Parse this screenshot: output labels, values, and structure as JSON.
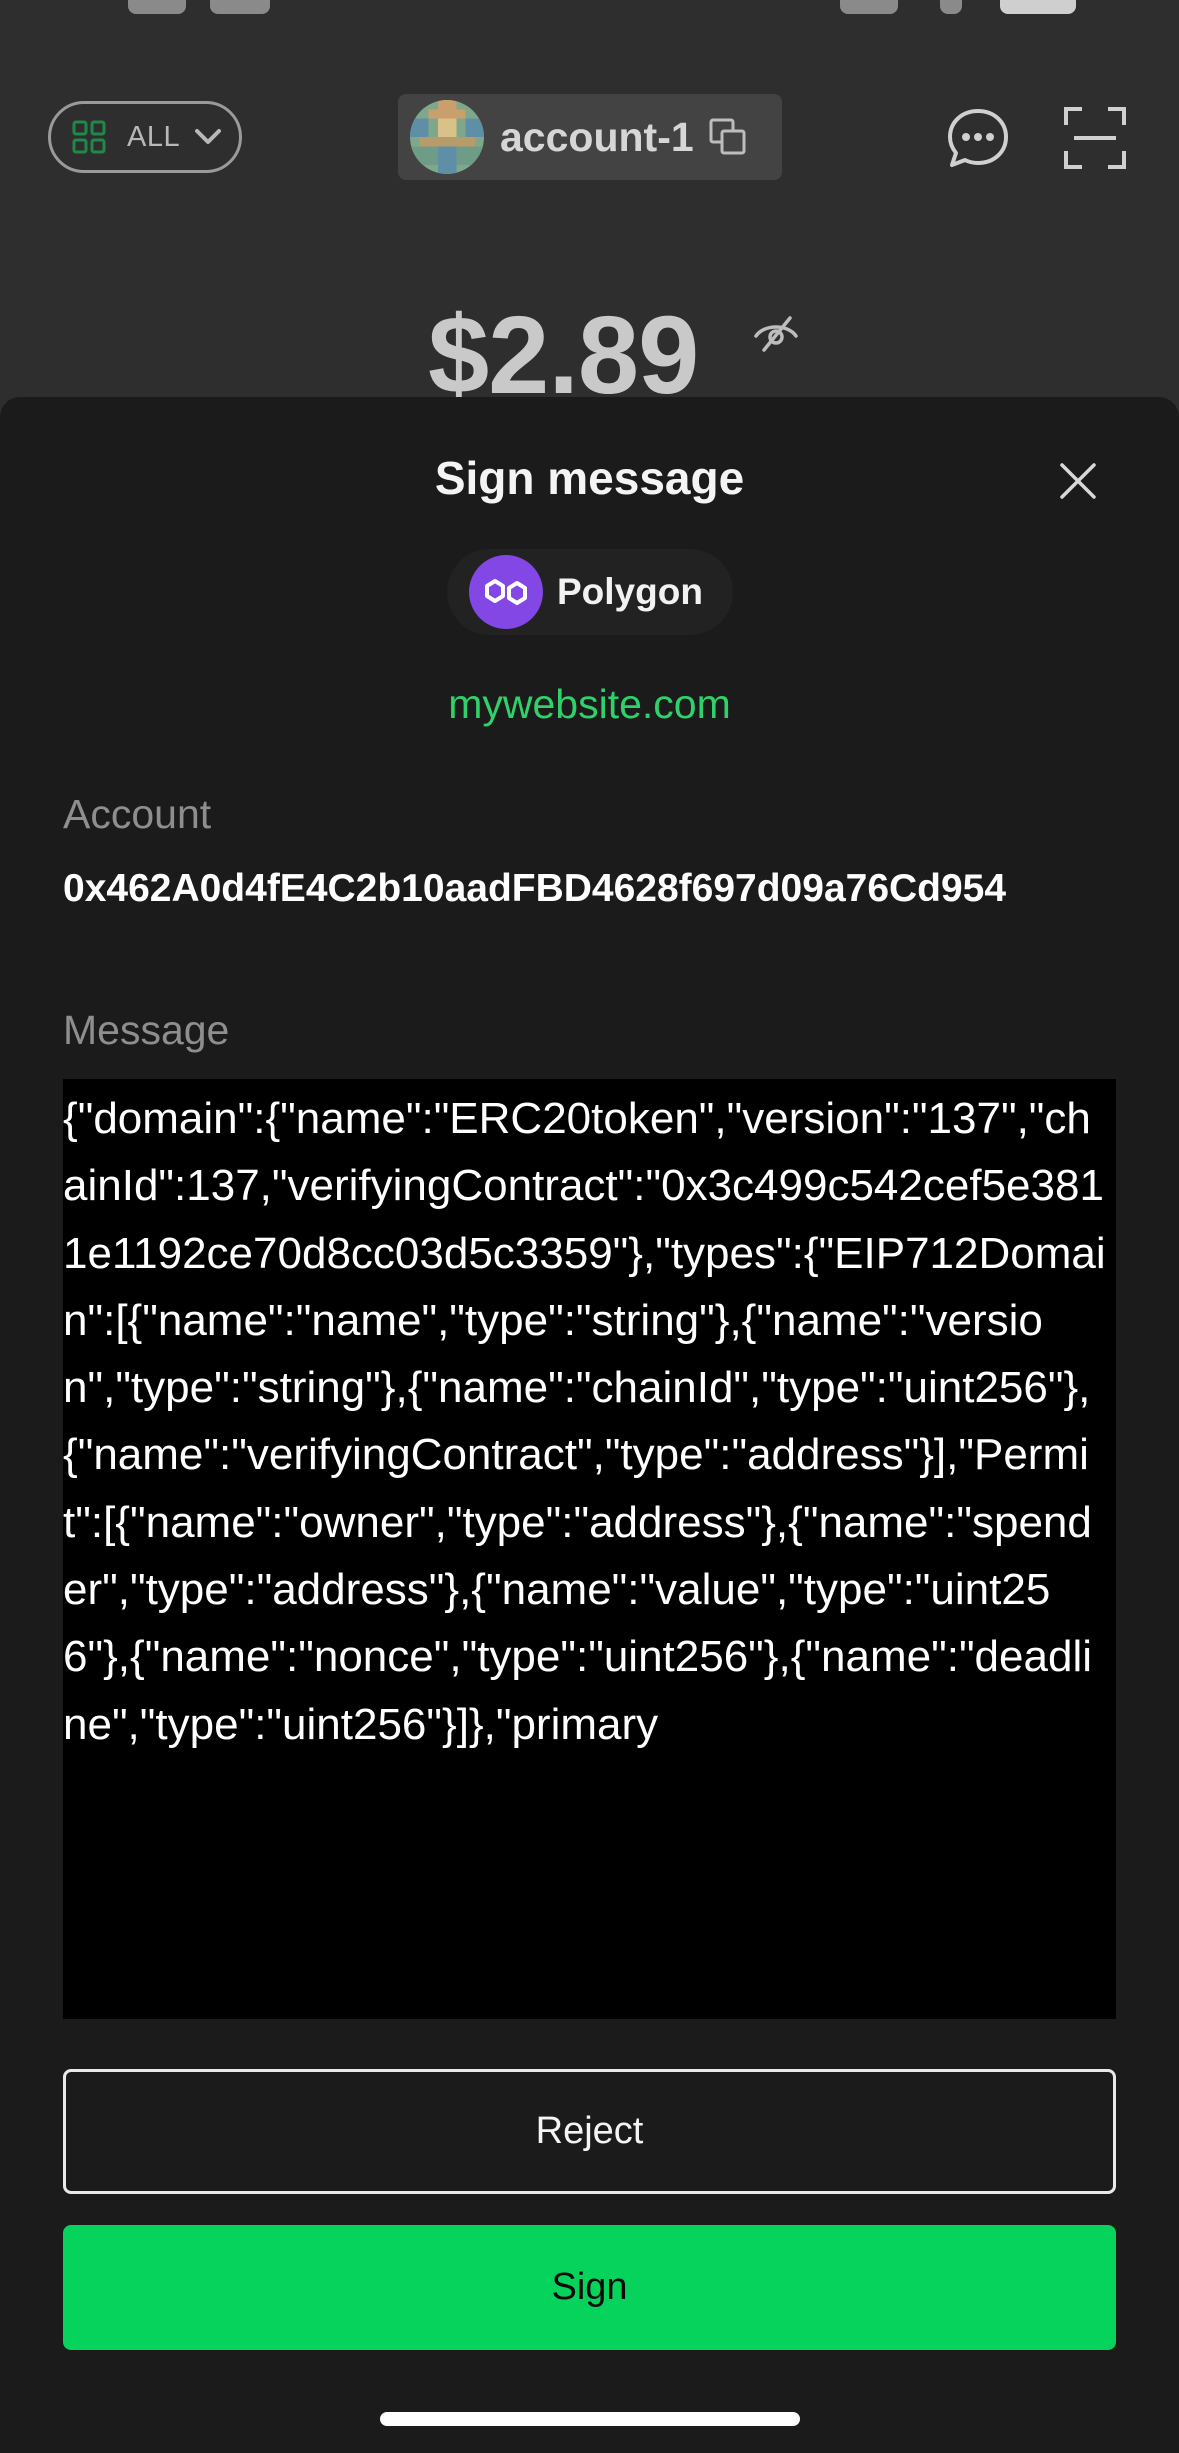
{
  "wallet_header": {
    "filter_label": "ALL",
    "account_name": "account-1"
  },
  "balance": {
    "amount": "$2.89"
  },
  "sign_sheet": {
    "title": "Sign message",
    "network": "Polygon",
    "site": "mywebsite.com",
    "account_label": "Account",
    "account_address": "0x462A0d4fE4C2b10aadFBD4628f697d09a76Cd954",
    "message_label": "Message",
    "message": "{\"domain\":{\"name\":\"ERC20token\",\"version\":\"137\",\"chainId\":137,\"verifyingContract\":\"0x3c499c542cef5e3811e1192ce70d8cc03d5c3359\"},\"types\":{\"EIP712Domain\":[{\"name\":\"name\",\"type\":\"string\"},{\"name\":\"version\",\"type\":\"string\"},{\"name\":\"chainId\",\"type\":\"uint256\"},{\"name\":\"verifyingContract\",\"type\":\"address\"}],\"Permit\":[{\"name\":\"owner\",\"type\":\"address\"},{\"name\":\"spender\",\"type\":\"address\"},{\"name\":\"value\",\"type\":\"uint256\"},{\"name\":\"nonce\",\"type\":\"uint256\"},{\"name\":\"deadline\",\"type\":\"uint256\"}]},\"primary",
    "reject_label": "Reject",
    "sign_label": "Sign"
  },
  "icons": {
    "filter": "grid-icon",
    "dropdown": "chevron-down-icon",
    "copy": "copy-icon",
    "chat": "chat-icon",
    "scan": "scan-icon",
    "hide_balance": "eye-off-icon",
    "close": "close-icon",
    "network": "polygon-logo-icon"
  },
  "colors": {
    "accent_green": "#06d35b",
    "site_green": "#2fd16a",
    "polygon_purple": "#8247e5",
    "sheet_background": "#1b1b1b",
    "message_background": "#000000"
  }
}
